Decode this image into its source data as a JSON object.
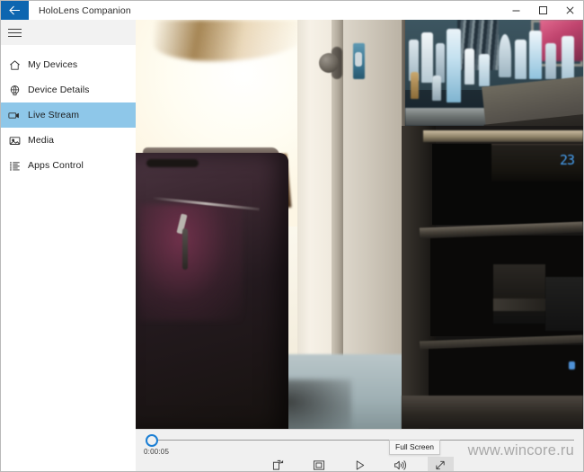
{
  "window": {
    "title": "HoloLens Companion",
    "back_icon": "back-arrow-icon",
    "minimize_label": "—",
    "maximize_label": "□",
    "close_label": "✕"
  },
  "sidebar": {
    "menu_icon": "hamburger-icon",
    "items": [
      {
        "label": "My Devices",
        "icon": "home-icon",
        "active": false
      },
      {
        "label": "Device Details",
        "icon": "device-info-icon",
        "active": false
      },
      {
        "label": "Live Stream",
        "icon": "video-camera-icon",
        "active": true
      },
      {
        "label": "Media",
        "icon": "photo-icon",
        "active": false
      },
      {
        "label": "Apps Control",
        "icon": "list-icon",
        "active": false
      }
    ]
  },
  "player": {
    "elapsed_time": "0:00:05",
    "progress_percent": 0,
    "tooltip": "Full Screen",
    "controls": [
      {
        "name": "cast-icon",
        "highlight": false
      },
      {
        "name": "mini-view-icon",
        "highlight": false
      },
      {
        "name": "play-icon",
        "highlight": false
      },
      {
        "name": "volume-icon",
        "highlight": false
      },
      {
        "name": "fullscreen-icon",
        "highlight": true
      }
    ]
  },
  "watermark": {
    "text": "www.wincore.ru"
  },
  "colors": {
    "accent_blue": "#0d66b0",
    "selection_blue": "#8ec7e9",
    "seek_thumb_blue": "#1b7fd4",
    "control_bar_bg": "#f0f0f0",
    "watermark_gray": "#a9a9a9"
  }
}
